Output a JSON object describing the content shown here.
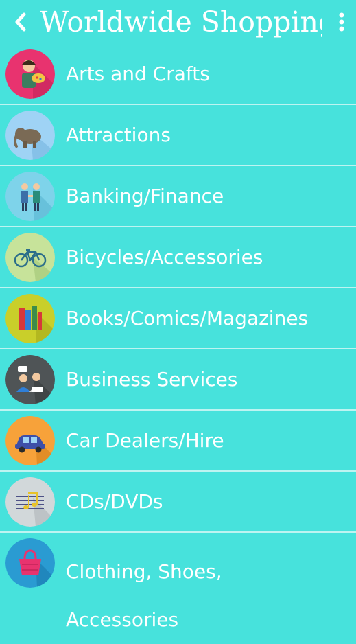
{
  "header": {
    "title": "Worldwide Shopping",
    "back_icon": "chevron-left-icon",
    "menu_icon": "more-vertical-icon"
  },
  "colors": {
    "background": "#47E2DC",
    "text": "#FFFFFF",
    "divider": "#BDF4F1"
  },
  "categories": [
    {
      "label": "Arts and Crafts",
      "icon": "painter-icon",
      "icon_bg": "#E8336F"
    },
    {
      "label": "Attractions",
      "icon": "elephant-icon",
      "icon_bg": "#9FD3F5"
    },
    {
      "label": "Banking/Finance",
      "icon": "handshake-icon",
      "icon_bg": "#7ED3EA"
    },
    {
      "label": "Bicycles/Accessories",
      "icon": "bicycle-icon",
      "icon_bg": "#C7E39A"
    },
    {
      "label": "Books/Comics/Magazines",
      "icon": "books-icon",
      "icon_bg": "#C9CF2A"
    },
    {
      "label": "Business Services",
      "icon": "business-people-icon",
      "icon_bg": "#4F5456"
    },
    {
      "label": "Car Dealers/Hire",
      "icon": "car-icon",
      "icon_bg": "#F7A23A"
    },
    {
      "label": "CDs/DVDs",
      "icon": "music-notes-icon",
      "icon_bg": "#D2D8DA"
    },
    {
      "label": "Clothing, Shoes, Accessories",
      "icon": "shopping-bag-icon",
      "icon_bg": "#2A9BD2"
    }
  ]
}
